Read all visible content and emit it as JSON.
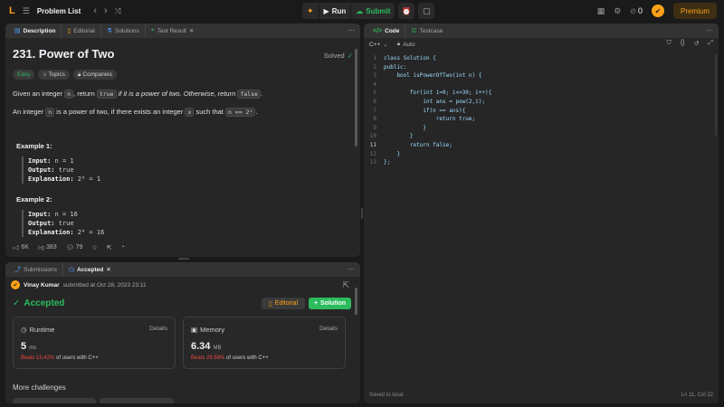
{
  "topbar": {
    "logo": "L",
    "list_icon": "☰",
    "problem_list": "Problem List",
    "prev": "‹",
    "next": "›",
    "shuffle": "⤨",
    "debug_icon": "✦",
    "run": "Run",
    "submit": "Submit",
    "timer_icon": "⏰",
    "note_icon": "▢",
    "layout_icon": "▦",
    "settings_icon": "⚙",
    "streak": "0",
    "premium": "Premium"
  },
  "desc_panel": {
    "tabs": [
      {
        "label": "Description",
        "icon": "▤"
      },
      {
        "label": "Editorial",
        "icon": "▯"
      },
      {
        "label": "Solutions",
        "icon": "⚗"
      },
      {
        "label": "Test Result",
        "icon": "⌖"
      }
    ],
    "title": "231. Power of Two",
    "solved": "Solved",
    "chips": [
      "Easy",
      "Topics",
      "Companies"
    ],
    "p1": {
      "a": "Given an integer ",
      "n": "n",
      "b": ", return ",
      "true": "true",
      "c": " if it is a power of two. Otherwise, return ",
      "false": "false",
      "d": "."
    },
    "p2": {
      "a": "An integer ",
      "n": "n",
      "b": " is a power of two, if there exists an integer ",
      "x": "x",
      "c": " such that ",
      "expr": "n == 2ˣ",
      "d": "."
    },
    "example1": {
      "title": "Example 1:",
      "input_label": "Input:",
      "input": " n = 1",
      "output_label": "Output:",
      "output": " true",
      "expl_label": "Explanation:",
      "expl": " 2⁰ = 1"
    },
    "example2": {
      "title": "Example 2:",
      "input_label": "Input:",
      "input": " n = 16",
      "output_label": "Output:",
      "output": " true",
      "expl_label": "Explanation:",
      "expl": " 2⁴ = 16"
    },
    "footer": {
      "likes": "6K",
      "dislikes": "383",
      "comments": "79"
    }
  },
  "sub_panel": {
    "tabs": [
      {
        "label": "Submissions",
        "icon": "⤴"
      },
      {
        "label": "Accepted",
        "icon": "◷"
      }
    ],
    "user": "Vinay Kumar",
    "submitted_at": "submitted at Oct 28, 2023 23:11",
    "accepted": "Accepted",
    "editorial_btn": "Editorial",
    "solution_btn": "Solution",
    "runtime": {
      "title": "Runtime",
      "details": "Details",
      "value": "5",
      "unit": "ms",
      "beats": "Beats 15.42%",
      "suffix": " of users with C++"
    },
    "memory": {
      "title": "Memory",
      "details": "Details",
      "value": "6.34",
      "unit": "MB",
      "beats": "Beats 29.58%",
      "suffix": " of users with C++"
    },
    "more_challenges": "More challenges"
  },
  "code_panel": {
    "tabs": [
      {
        "label": "Code",
        "icon": "</>"
      },
      {
        "label": "Testcase",
        "icon": "☑"
      }
    ],
    "language": "C++",
    "auto": "Auto",
    "lines": [
      {
        "n": "1",
        "t": "class Solution {"
      },
      {
        "n": "2",
        "t": "public:"
      },
      {
        "n": "3",
        "t": "    bool isPowerOfTwo(int n) {"
      },
      {
        "n": "4",
        "t": ""
      },
      {
        "n": "5",
        "t": "        for(int i=0; i<=30; i++){"
      },
      {
        "n": "6",
        "t": "            int ans = pow(2,i);"
      },
      {
        "n": "7",
        "t": "            if(n == ans){"
      },
      {
        "n": "8",
        "t": "                return true;"
      },
      {
        "n": "9",
        "t": "            }"
      },
      {
        "n": "10",
        "t": "        }"
      },
      {
        "n": "11",
        "t": "        return false;"
      },
      {
        "n": "12",
        "t": "    }"
      },
      {
        "n": "13",
        "t": "};"
      }
    ],
    "status": "Saved to local",
    "position": "Ln 11, Col 22"
  },
  "colors": {
    "accent": "#ffa116",
    "success": "#2cbb5d",
    "danger": "#ef4743"
  }
}
